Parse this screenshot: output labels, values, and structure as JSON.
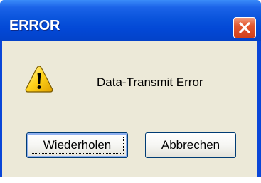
{
  "window": {
    "title": "ERROR",
    "close_icon": "close-x-icon"
  },
  "dialog": {
    "icon": "warning-triangle-icon",
    "message": "Data-Transmit Error"
  },
  "buttons": {
    "retry_label": "Wiederholen",
    "retry_accelerator": "h",
    "cancel_label": "Abbrechen"
  },
  "colors": {
    "titlebar": "#0348d6",
    "close_button": "#e4582f",
    "client_background": "#ece9d8",
    "warning_fill": "#ffd21a"
  }
}
